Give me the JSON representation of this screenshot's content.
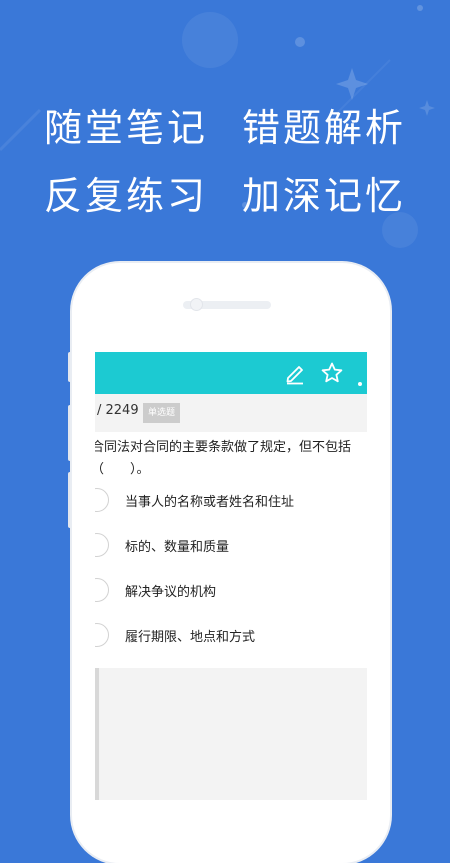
{
  "headline": {
    "line1_left": "随堂笔记",
    "line1_right": "错题解析",
    "line2_left": "反复练习",
    "line2_right": "加深记忆"
  },
  "colors": {
    "background": "#3a78d8",
    "toolbar": "#1ccad2",
    "badge": "#cccccc"
  },
  "toolbar": {
    "icons": [
      "edit-icon",
      "star-icon",
      "more-dot-icon"
    ]
  },
  "question_info": {
    "counter": "/ 2249",
    "type_badge": "单选题"
  },
  "question": {
    "text": "合同法对合同的主要条款做了规定，但不包括（　　）。",
    "options": [
      "当事人的名称或者姓名和住址",
      "标的、数量和质量",
      "解决争议的机构",
      "履行期限、地点和方式"
    ]
  }
}
